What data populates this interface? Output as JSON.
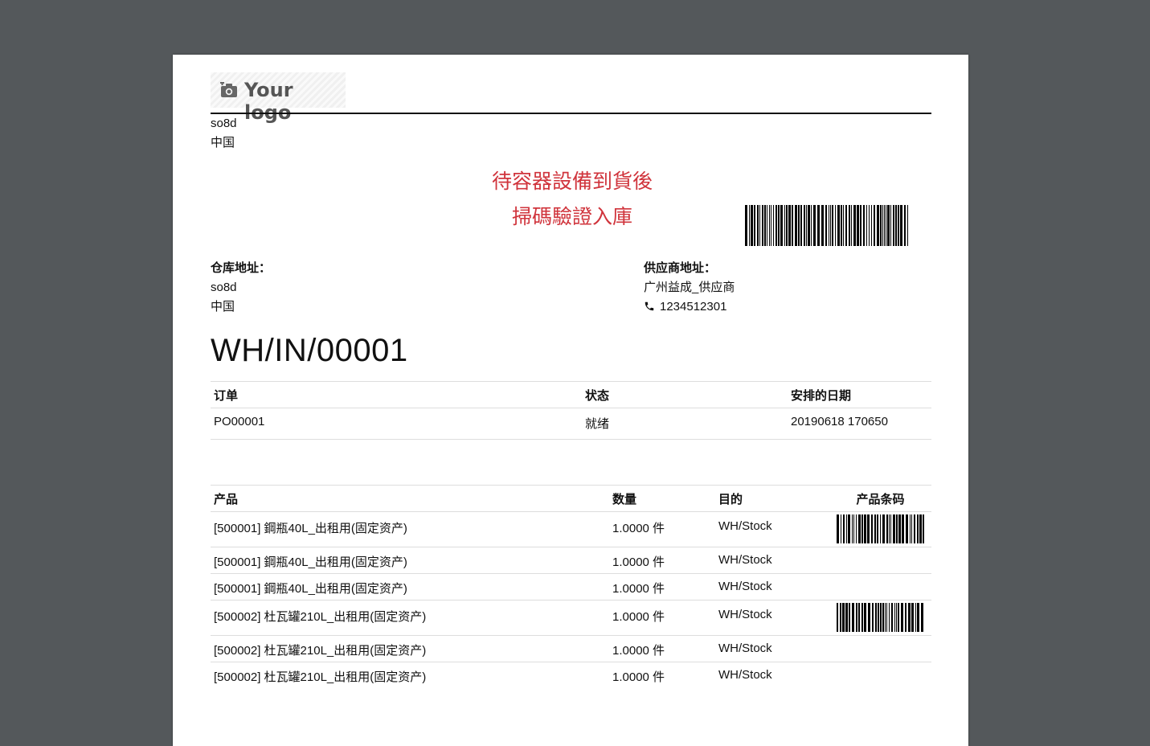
{
  "logo": {
    "text": "Your logo",
    "icon": "camera-icon"
  },
  "company": {
    "name": "so8d",
    "country": "中国"
  },
  "notice": {
    "line1": "待容器設備到貨後",
    "line2": "掃碼驗證入庫"
  },
  "warehouse": {
    "label": "仓库地址：",
    "name": "so8d",
    "country": "中国"
  },
  "vendor": {
    "label": "供应商地址：",
    "name": "广州益成_供应商",
    "phone_icon": "phone-icon",
    "phone": "1234512301"
  },
  "reference": "WH/IN/00001",
  "order_table": {
    "headers": [
      "订单",
      "状态",
      "安排的日期"
    ],
    "row": [
      "PO00001",
      "就绪",
      "20190618 170650"
    ]
  },
  "lines_table": {
    "headers": [
      "产品",
      "数量",
      "目的",
      "产品条码"
    ],
    "rows": [
      [
        "[500001] 鋼瓶40L_出租用(固定资产)",
        "1.0000 件",
        "WH/Stock"
      ],
      [
        "[500001] 鋼瓶40L_出租用(固定资产)",
        "1.0000 件",
        "WH/Stock"
      ],
      [
        "[500001] 鋼瓶40L_出租用(固定资产)",
        "1.0000 件",
        "WH/Stock"
      ],
      [
        "[500002] 杜瓦罐210L_出租用(固定资产)",
        "1.0000 件",
        "WH/Stock"
      ],
      [
        "[500002] 杜瓦罐210L_出租用(固定资产)",
        "1.0000 件",
        "WH/Stock"
      ],
      [
        "[500002] 杜瓦罐210L_出租用(固定资产)",
        "1.0000 件",
        "WH/Stock"
      ]
    ]
  },
  "colors": {
    "notice": "#d0343c",
    "background": "#54585b"
  }
}
